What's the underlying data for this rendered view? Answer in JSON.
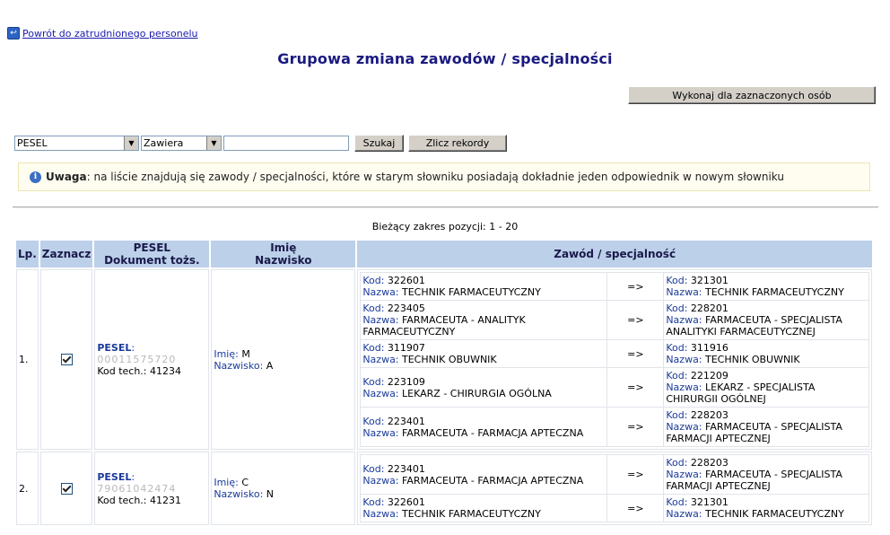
{
  "back_link": "Powrót do zatrudnionego personelu",
  "title": "Grupowa zmiana zawodów / specjalności",
  "execute_button": "Wykonaj dla zaznaczonych osób",
  "filter": {
    "field_select": "PESEL",
    "operator_select": "Zawiera",
    "search_value": "",
    "search_button": "Szukaj",
    "count_button": "Zlicz rekordy"
  },
  "notice": {
    "bold": "Uwaga",
    "text": ": na liście znajdują się zawody / specjalności, które w starym słowniku posiadają dokładnie jeden odpowiednik w nowym słowniku"
  },
  "range_text": "Bieżący zakres pozycji: 1 - 20",
  "table": {
    "headers": {
      "lp": "Lp.",
      "select": "Zaznacz",
      "pesel_line1": "PESEL",
      "pesel_line2": "Dokument tożs.",
      "name_line1": "Imię",
      "name_line2": "Nazwisko",
      "occupation": "Zawód / specjalność"
    },
    "labels": {
      "pesel": "PESEL",
      "kod_tech": "Kod tech.:",
      "imie": "Imię:",
      "nazwisko": "Nazwisko:",
      "kod": "Kod:",
      "nazwa": "Nazwa:",
      "arrow": "=>"
    },
    "rows": [
      {
        "lp": "1.",
        "checked": true,
        "pesel_masked": "00011575720",
        "kod_tech": "41234",
        "imie": "M",
        "nazwisko": "A",
        "occupations": [
          {
            "old_kod": "322601",
            "old_nazwa": "TECHNIK FARMACEUTYCZNY",
            "new_kod": "321301",
            "new_nazwa": "TECHNIK FARMACEUTYCZNY"
          },
          {
            "old_kod": "223405",
            "old_nazwa": "FARMACEUTA - ANALITYK FARMACEUTYCZNY",
            "new_kod": "228201",
            "new_nazwa": "FARMACEUTA - SPECJALISTA ANALITYKI FARMACEUTYCZNEJ"
          },
          {
            "old_kod": "311907",
            "old_nazwa": "TECHNIK OBUWNIK",
            "new_kod": "311916",
            "new_nazwa": "TECHNIK OBUWNIK"
          },
          {
            "old_kod": "223109",
            "old_nazwa": "LEKARZ - CHIRURGIA OGÓLNA",
            "new_kod": "221209",
            "new_nazwa": "LEKARZ - SPECJALISTA CHIRURGII OGÓLNEJ"
          },
          {
            "old_kod": "223401",
            "old_nazwa": "FARMACEUTA - FARMACJA APTECZNA",
            "new_kod": "228203",
            "new_nazwa": "FARMACEUTA - SPECJALISTA FARMACJI APTECZNEJ"
          }
        ]
      },
      {
        "lp": "2.",
        "checked": true,
        "pesel_masked": "79061042474",
        "kod_tech": "41231",
        "imie": "C",
        "nazwisko": "N",
        "occupations": [
          {
            "old_kod": "223401",
            "old_nazwa": "FARMACEUTA - FARMACJA APTECZNA",
            "new_kod": "228203",
            "new_nazwa": "FARMACEUTA - SPECJALISTA FARMACJI APTECZNEJ"
          },
          {
            "old_kod": "322601",
            "old_nazwa": "TECHNIK FARMACEUTYCZNY",
            "new_kod": "321301",
            "new_nazwa": "TECHNIK FARMACEUTYCZNY"
          }
        ]
      }
    ]
  },
  "colors": {
    "title": "#1a1a80",
    "header_bg": "#bcd0ea",
    "label": "#1a3a9a",
    "notice_bg": "#fffdf0"
  }
}
